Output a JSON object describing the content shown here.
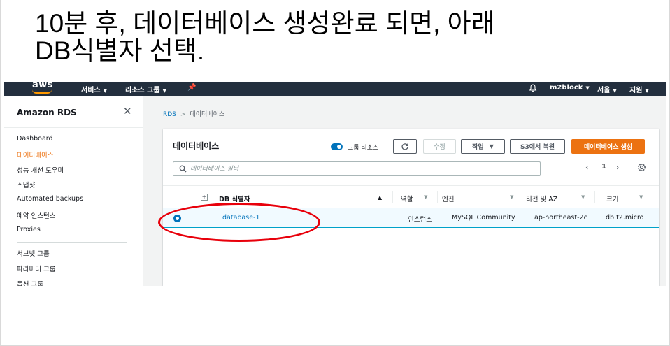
{
  "slide": {
    "heading_line1": "10분 후, 데이터베이스 생성완료 되면, 아래",
    "heading_line2": "DB식별자 선택."
  },
  "topnav": {
    "logo": "aws",
    "services": "서비스",
    "resource_groups": "리소스 그룹",
    "account": "m2block",
    "region": "서울",
    "support": "지원"
  },
  "sidebar": {
    "title": "Amazon RDS",
    "items": [
      {
        "label": "Dashboard"
      },
      {
        "label": "데이터베이스",
        "active": true
      },
      {
        "label": "성능 개선 도우미"
      },
      {
        "label": "스냅샷"
      },
      {
        "label": "Automated backups"
      },
      {
        "label": "예약 인스턴스"
      },
      {
        "label": "Proxies"
      },
      {
        "label": "서브넷 그룹"
      },
      {
        "label": "파라미터 그룹"
      },
      {
        "label": "옵션 그룹"
      }
    ]
  },
  "breadcrumb": {
    "root": "RDS",
    "current": "데이터베이스"
  },
  "panel": {
    "title": "데이터베이스",
    "group_resources_label": "그룹 리소스",
    "buttons": {
      "modify": "수정",
      "actions": "작업",
      "restore_s3": "S3에서 복원",
      "create": "데이터베이스 생성"
    },
    "search_placeholder": "데이터베이스 필터",
    "page_number": "1",
    "columns": {
      "db_identifier": "DB 식별자",
      "role": "역할",
      "engine": "엔진",
      "region_az": "리전 및 AZ",
      "size": "크기"
    },
    "rows": [
      {
        "db_identifier": "database-1",
        "role": "인스턴스",
        "engine": "MySQL Community",
        "region_az": "ap-northeast-2c",
        "size": "db.t2.micro",
        "selected": true
      }
    ]
  },
  "colors": {
    "nav_bg": "#232f3e",
    "accent_orange": "#ec7211",
    "link_blue": "#0073bb",
    "annotation_red": "#e8000b"
  }
}
